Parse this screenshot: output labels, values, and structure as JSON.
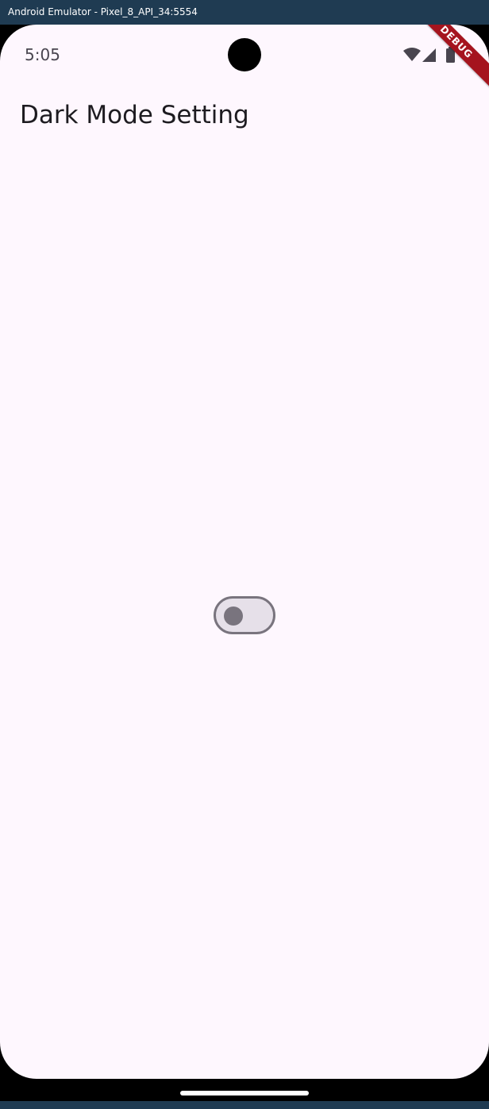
{
  "window": {
    "title": "Android Emulator - Pixel_8_API_34:5554"
  },
  "status_bar": {
    "time": "5:05",
    "icons": [
      "wifi-icon",
      "cell-signal-icon",
      "battery-icon"
    ]
  },
  "debug_banner": {
    "label": "DEBUG"
  },
  "app": {
    "title": "Dark Mode Setting",
    "dark_mode_switch": {
      "state": "off"
    }
  },
  "colors": {
    "screen_background": "#fef7fe",
    "title_text": "#1d1b20",
    "switch_outline": "#79747e",
    "switch_track": "#e6e0e9",
    "debug_banner": "#a5141e",
    "window_titlebar": "#1f3b52"
  }
}
